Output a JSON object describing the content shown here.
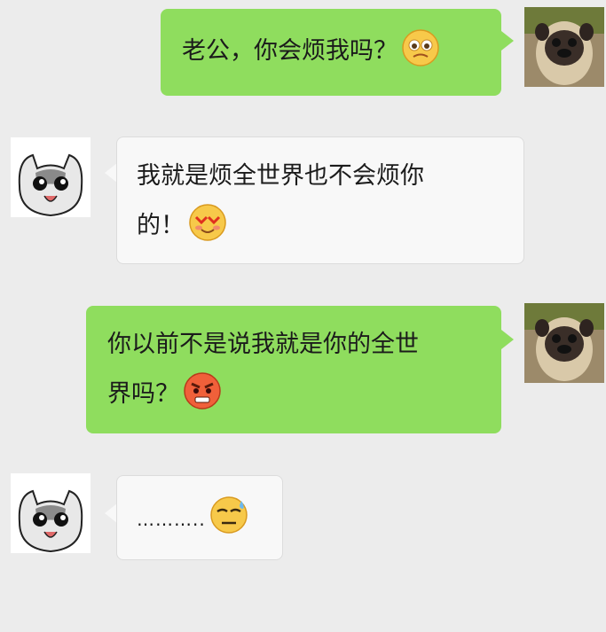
{
  "messages": [
    {
      "side": "out",
      "lines": [
        "老公，你会烦我吗？"
      ],
      "emoji": "pleading-face-icon"
    },
    {
      "side": "in",
      "lines": [
        "我就是烦全世界也不会烦你",
        "的！"
      ],
      "emoji": "heart-eyes-face-icon"
    },
    {
      "side": "out",
      "lines": [
        "你以前不是说我就是你的全世",
        "界吗？"
      ],
      "emoji": "angry-face-icon"
    },
    {
      "side": "in",
      "lines": [
        "……….."
      ],
      "emoji": "sweat-face-icon"
    }
  ],
  "avatars": {
    "self": "pug-avatar",
    "other": "cat-avatar"
  },
  "colors": {
    "outgoing_bubble": "#8fdd5e",
    "incoming_bubble": "#f8f8f8",
    "background": "#ececec"
  }
}
